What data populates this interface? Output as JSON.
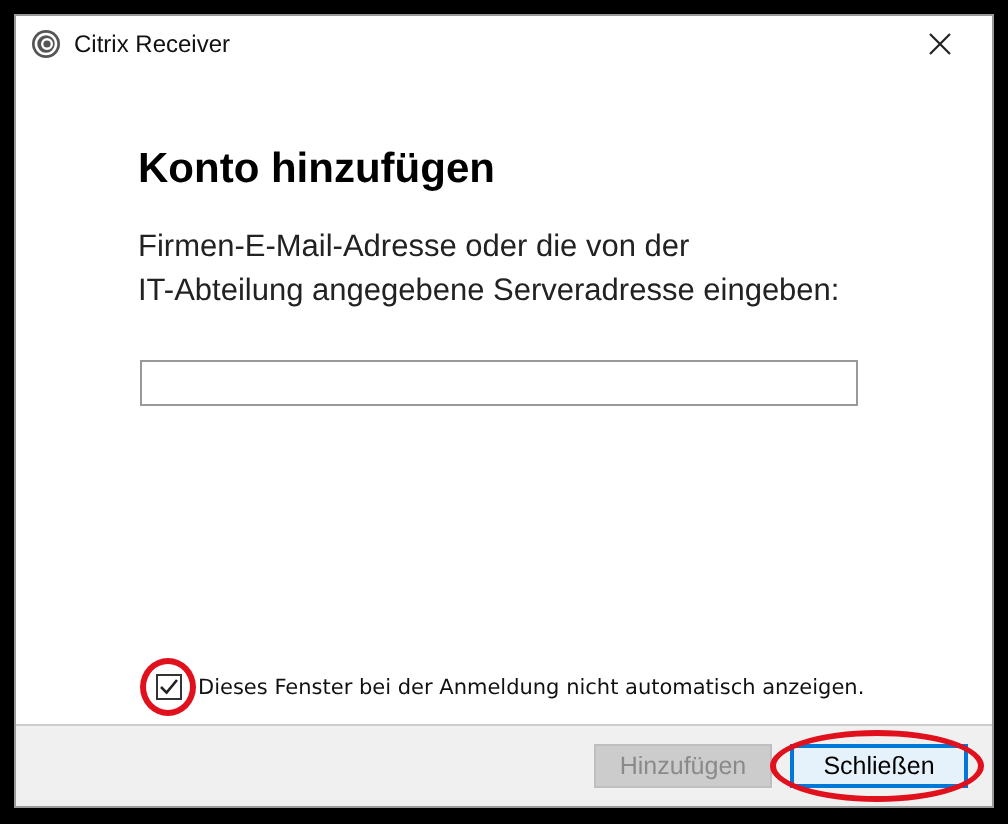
{
  "window": {
    "title": "Citrix Receiver"
  },
  "heading": "Konto hinzufügen",
  "instructions": [
    "Firmen-E-Mail-Adresse oder die von der",
    "IT-Abteilung angegebene Serveradresse eingeben:"
  ],
  "checkbox": {
    "label": "Dieses Fenster bei der Anmeldung nicht automatisch anzeigen.",
    "checked": true,
    "circled": true
  },
  "buttons": [
    {
      "label": "Hinzufügen",
      "disabled": true,
      "focused": false,
      "circled": false
    },
    {
      "label": "Schließen",
      "disabled": false,
      "focused": true,
      "circled": true
    }
  ]
}
